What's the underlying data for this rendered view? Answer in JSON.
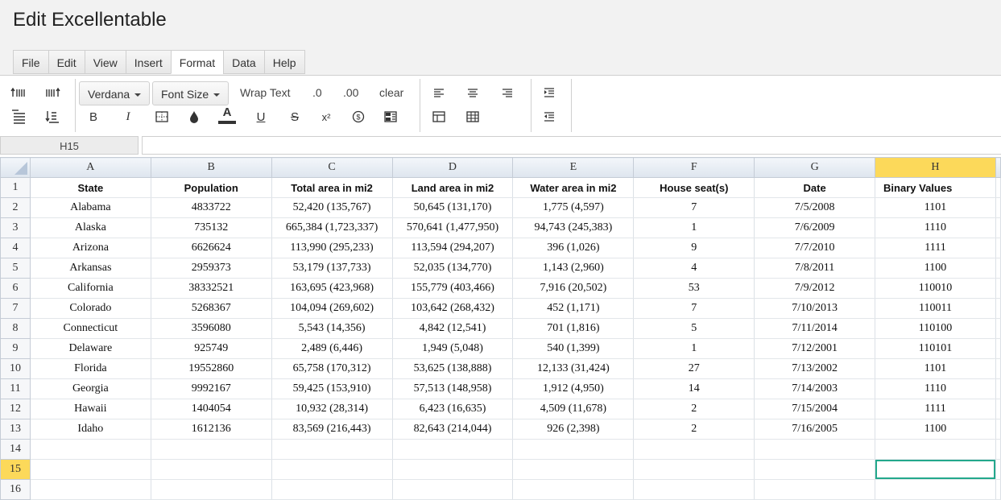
{
  "app": {
    "title": "Edit Excellentable"
  },
  "menu": [
    {
      "label": "File",
      "active": false
    },
    {
      "label": "Edit",
      "active": false
    },
    {
      "label": "View",
      "active": false
    },
    {
      "label": "Insert",
      "active": false
    },
    {
      "label": "Format",
      "active": true
    },
    {
      "label": "Data",
      "active": false
    },
    {
      "label": "Help",
      "active": false
    }
  ],
  "toolbar": {
    "font_family": "Verdana",
    "font_size": "Font Size",
    "wrap_text": "Wrap Text",
    "decimal_decrease": ".0",
    "decimal_increase": ".00",
    "clear": "clear",
    "bold": "B",
    "italic": "I",
    "font_color": "A",
    "underline": "U",
    "strike": "S",
    "superscript": "x²"
  },
  "formula_bar": {
    "cell_ref": "H15",
    "value": ""
  },
  "grid": {
    "selected_cell": "H15",
    "columns": [
      "A",
      "B",
      "C",
      "D",
      "E",
      "F",
      "G",
      "H"
    ],
    "selected_column": "H",
    "selected_row": 15,
    "rows": [
      [
        "State",
        "Population",
        "Total area in mi2",
        "Land area in mi2",
        "Water area in mi2",
        "House seat(s)",
        "Date",
        "Binary Values"
      ],
      [
        "Alabama",
        "4833722",
        "52,420 (135,767)",
        "50,645 (131,170)",
        "1,775 (4,597)",
        "7",
        "7/5/2008",
        "1101"
      ],
      [
        "Alaska",
        "735132",
        "665,384 (1,723,337)",
        "570,641 (1,477,950)",
        "94,743 (245,383)",
        "1",
        "7/6/2009",
        "1110"
      ],
      [
        "Arizona",
        "6626624",
        "113,990 (295,233)",
        "113,594 (294,207)",
        "396 (1,026)",
        "9",
        "7/7/2010",
        "1111"
      ],
      [
        "Arkansas",
        "2959373",
        "53,179 (137,733)",
        "52,035 (134,770)",
        "1,143 (2,960)",
        "4",
        "7/8/2011",
        "1100"
      ],
      [
        "California",
        "38332521",
        "163,695 (423,968)",
        "155,779 (403,466)",
        "7,916 (20,502)",
        "53",
        "7/9/2012",
        "110010"
      ],
      [
        "Colorado",
        "5268367",
        "104,094 (269,602)",
        "103,642 (268,432)",
        "452 (1,171)",
        "7",
        "7/10/2013",
        "110011"
      ],
      [
        "Connecticut",
        "3596080",
        "5,543 (14,356)",
        "4,842 (12,541)",
        "701 (1,816)",
        "5",
        "7/11/2014",
        "110100"
      ],
      [
        "Delaware",
        "925749",
        "2,489 (6,446)",
        "1,949 (5,048)",
        "540 (1,399)",
        "1",
        "7/12/2001",
        "110101"
      ],
      [
        "Florida",
        "19552860",
        "65,758 (170,312)",
        "53,625 (138,888)",
        "12,133 (31,424)",
        "27",
        "7/13/2002",
        "1101"
      ],
      [
        "Georgia",
        "9992167",
        "59,425 (153,910)",
        "57,513 (148,958)",
        "1,912 (4,950)",
        "14",
        "7/14/2003",
        "1110"
      ],
      [
        "Hawaii",
        "1404054",
        "10,932 (28,314)",
        "6,423 (16,635)",
        "4,509 (11,678)",
        "2",
        "7/15/2004",
        "1111"
      ],
      [
        "Idaho",
        "1612136",
        "83,569 (216,443)",
        "82,643 (214,044)",
        "926 (2,398)",
        "2",
        "7/16/2005",
        "1100"
      ],
      [
        "",
        "",
        "",
        "",
        "",
        "",
        "",
        ""
      ],
      [
        "",
        "",
        "",
        "",
        "",
        "",
        "",
        ""
      ],
      [
        "",
        "",
        "",
        "",
        "",
        "",
        "",
        ""
      ]
    ]
  }
}
